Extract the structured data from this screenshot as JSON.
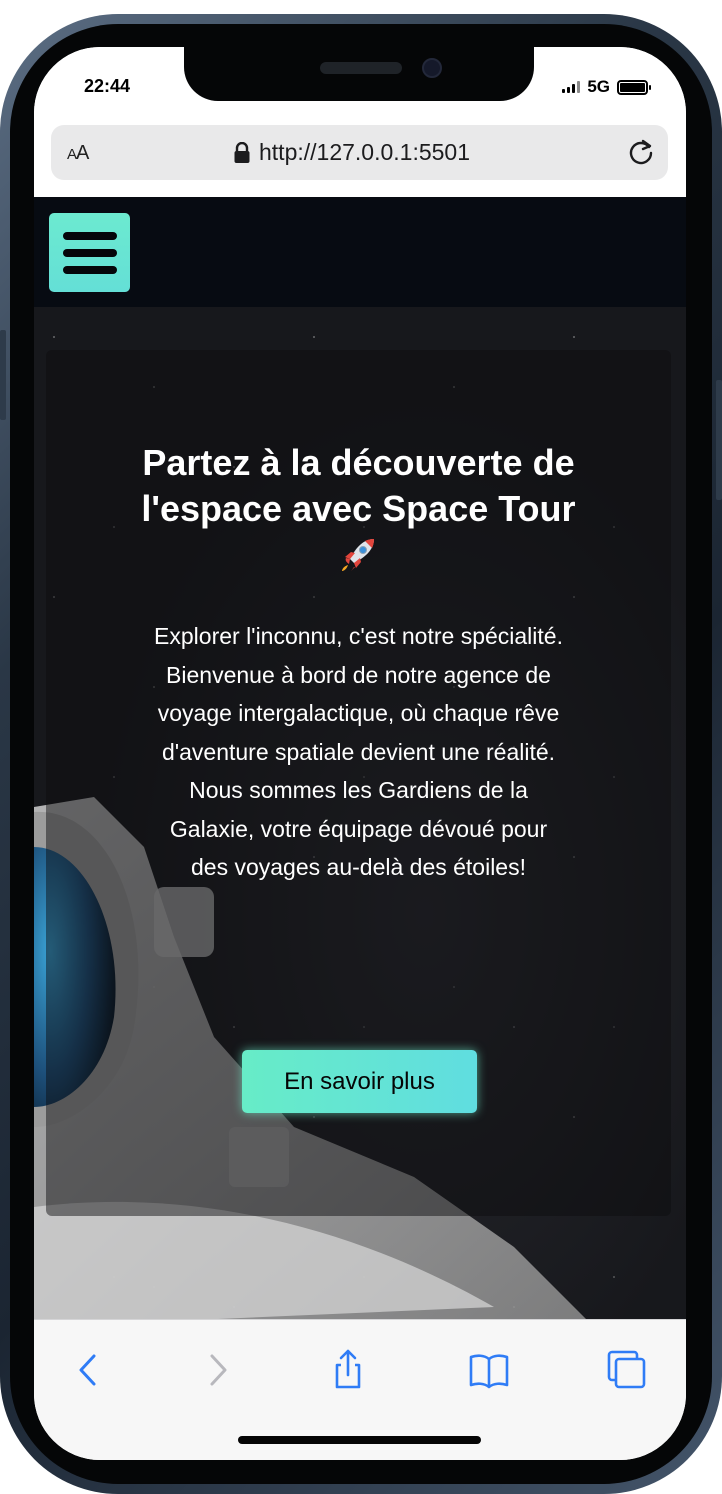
{
  "status_bar": {
    "time": "22:44",
    "network": "5G"
  },
  "browser": {
    "text_size_small": "A",
    "text_size_large": "A",
    "url": "http://127.0.0.1:5501",
    "toolbar_icons": [
      "chevron-back-icon",
      "chevron-forward-icon",
      "share-icon",
      "bookmarks-icon",
      "tabs-icon"
    ],
    "accent_color": "#2f7cf6",
    "disabled_color": "#b8b8bd"
  },
  "page": {
    "brand_accent": "#67ecc7",
    "hero": {
      "title": "Partez à la découverte de l'espace avec Space Tour",
      "title_emoji": "rocket-icon",
      "description_lines": [
        "Explorer l'inconnu, c'est notre spécialité.",
        "Bienvenue à bord de notre agence de voyage intergalactique, où chaque rêve d'aventure spatiale devient une réalité.",
        "Nous sommes les Gardiens de la Galaxie, votre équipage dévoué pour des voyages au-delà des étoiles!"
      ],
      "cta_label": "En savoir plus"
    }
  }
}
